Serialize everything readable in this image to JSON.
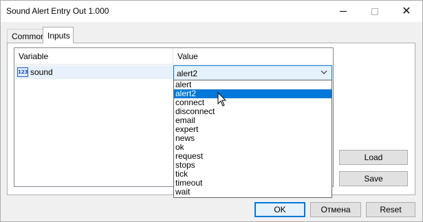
{
  "window": {
    "title": "Sound Alert Entry Out 1.000"
  },
  "tabs": [
    {
      "label": "Common"
    },
    {
      "label": "Inputs"
    }
  ],
  "grid": {
    "headers": {
      "variable": "Variable",
      "value": "Value"
    },
    "rows": [
      {
        "icon": "param-number-icon",
        "icon_text": "123",
        "name": "sound",
        "value": "alert2"
      }
    ]
  },
  "dropdown": {
    "options": [
      "alert",
      "alert2",
      "connect",
      "disconnect",
      "email",
      "expert",
      "news",
      "ok",
      "request",
      "stops",
      "tick",
      "timeout",
      "wait"
    ],
    "selected": "alert2"
  },
  "buttons": {
    "load": "Load",
    "save": "Save",
    "ok": "OK",
    "cancel": "Отмена",
    "reset": "Reset"
  },
  "colors": {
    "accent": "#0078d7",
    "selection": "#0078d7",
    "row_highlight": "#e8f1fb"
  }
}
